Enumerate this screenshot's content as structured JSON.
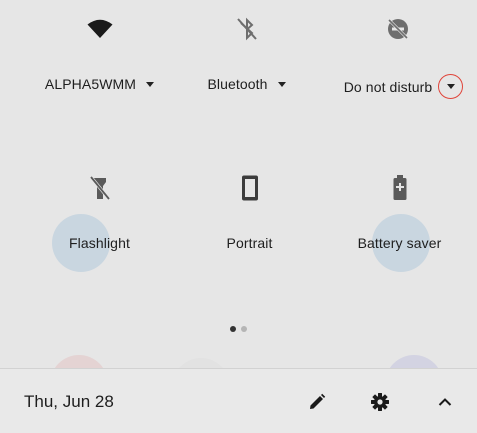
{
  "quick_settings": {
    "row1": [
      {
        "label": "ALPHA5WMM",
        "icon": "wifi-icon"
      },
      {
        "label": "Bluetooth",
        "icon": "bluetooth-off-icon"
      },
      {
        "label": "Do not disturb",
        "icon": "dnd-off-icon"
      }
    ],
    "row2": [
      {
        "label": "Flashlight",
        "icon": "flashlight-off-icon"
      },
      {
        "label": "Portrait",
        "icon": "portrait-icon"
      },
      {
        "label": "Battery saver",
        "icon": "battery-saver-icon"
      }
    ],
    "page_indicator": {
      "pages": 2,
      "current": 1
    }
  },
  "footer": {
    "date": "Thu, Jun 28"
  },
  "colors": {
    "background": "#e6e6e6",
    "icon": "#3c3c3c",
    "icon_muted": "#6e6e6e",
    "highlight_ring": "#e0443a",
    "dot_active": "#333333",
    "dot_inactive": "#b5b5b5"
  }
}
